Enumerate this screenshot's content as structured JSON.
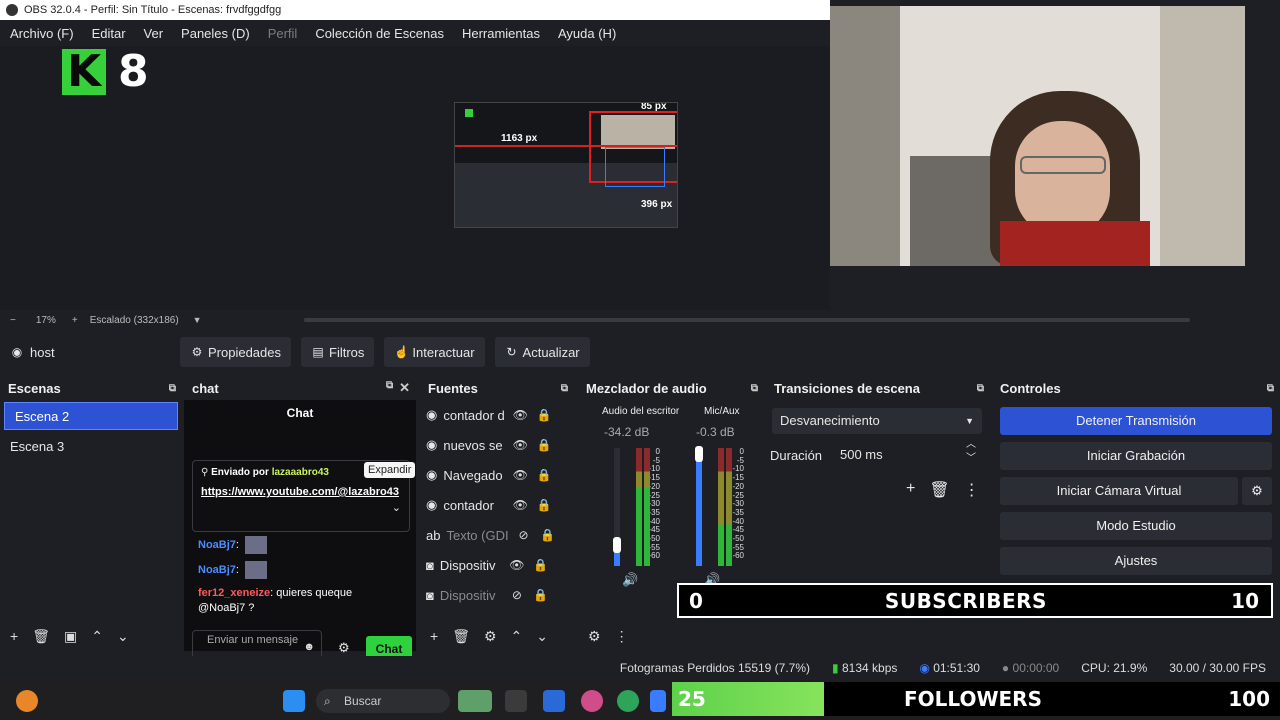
{
  "window": {
    "title": "OBS 32.0.4 - Perfil: Sin Título - Escenas: frvdfggdfgg"
  },
  "menu": {
    "items": [
      "Archivo (F)",
      "Editar",
      "Ver",
      "Paneles (D)",
      "Perfil",
      "Colección de Escenas",
      "Herramientas",
      "Ayuda (H)"
    ]
  },
  "preview": {
    "logo_letter": "K",
    "logo_number": "8",
    "mini_labels": {
      "width": "1163 px",
      "top": "85 px",
      "bottom": "396 px"
    }
  },
  "preview_status": {
    "zoom": "17%",
    "plus": "+",
    "minus": "−",
    "scale": "Escalado (332x186)"
  },
  "source_toolbar": {
    "current": "host",
    "buttons": [
      "Propiedades",
      "Filtros",
      "Interactuar",
      "Actualizar"
    ]
  },
  "scenes": {
    "title": "Escenas",
    "items": [
      "Escena 2",
      "Escena 3"
    ]
  },
  "chat": {
    "dock_title": "chat",
    "title": "Chat",
    "sent_by": "Enviado por",
    "sender": "lazaaabro43",
    "tooltip": "Expandir",
    "link": "https://www.youtube.com/@lazabro43",
    "messages": [
      {
        "user": "NoaBj7",
        "text": ""
      },
      {
        "user": "NoaBj7",
        "text": ""
      },
      {
        "user": "fer12_xeneize",
        "text": "quieres queque @NoaBj7 ?"
      }
    ],
    "input_placeholder": "Enviar un mensaje",
    "send_label": "Chat"
  },
  "sources": {
    "title": "Fuentes",
    "items": [
      {
        "name": "contador d",
        "visible": true
      },
      {
        "name": "nuevos se",
        "visible": true
      },
      {
        "name": "Navegado",
        "visible": true
      },
      {
        "name": "contador",
        "visible": true
      },
      {
        "name": "Texto (GDI",
        "visible": false
      },
      {
        "name": "Dispositiv",
        "visible": true
      },
      {
        "name": "Dispositiv",
        "visible": false
      }
    ]
  },
  "mixer": {
    "title": "Mezclador de audio",
    "channels": [
      {
        "name": "Audio del escritor",
        "db": "-34.2 dB",
        "level": 0.18
      },
      {
        "name": "Mic/Aux",
        "db": "-0.3 dB",
        "level": 0.95
      }
    ],
    "ticks": [
      "0",
      "-5",
      "-10",
      "-15",
      "-20",
      "-25",
      "-30",
      "-35",
      "-40",
      "-45",
      "-50",
      "-55",
      "-60"
    ]
  },
  "transitions": {
    "title": "Transiciones de escena",
    "selected": "Desvanecimiento",
    "duration_label": "Duración",
    "duration_value": "500 ms"
  },
  "controls": {
    "title": "Controles",
    "buttons": [
      "Detener Transmisión",
      "Iniciar Grabación",
      "Iniciar Cámara Virtual",
      "Modo Estudio",
      "Ajustes"
    ]
  },
  "overlays": {
    "subscribers": {
      "current": "0",
      "label": "SUBSCRIBERS",
      "goal": "10",
      "progress": 0
    },
    "followers": {
      "current": "25",
      "label": "FOLLOWERS",
      "goal": "100",
      "progress": 0.25
    }
  },
  "status": {
    "dropped": "Fotogramas Perdidos 15519 (7.7%)",
    "bitrate": "8134 kbps",
    "stream_time": "01:51:30",
    "rec_time": "00:00:00",
    "cpu": "CPU: 21.9%",
    "fps": "30.00 / 30.00 FPS"
  },
  "taskbar": {
    "search_placeholder": "Buscar"
  },
  "colors": {
    "accent": "#2d52d4",
    "chat_button": "#2ed23c",
    "logo": "#35d03a"
  }
}
